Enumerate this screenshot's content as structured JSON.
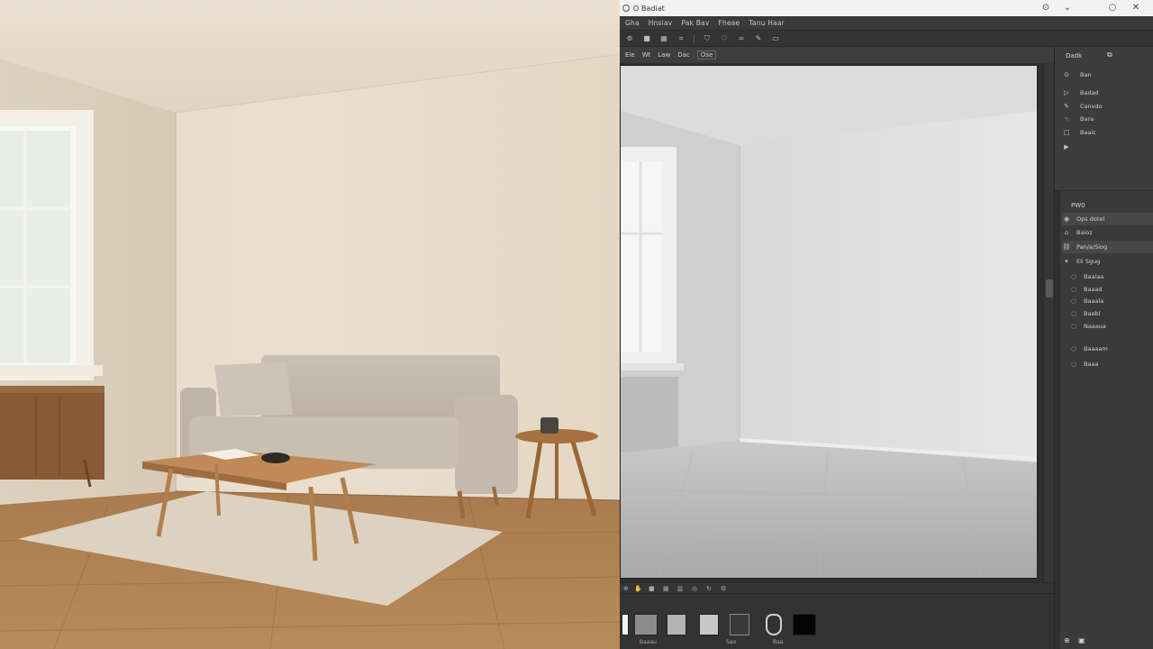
{
  "window": {
    "title": "Badiat"
  },
  "menu": {
    "items": [
      "Gha",
      "Hnsiav",
      "Pak Bav",
      "Fheae",
      "Tanu Haar"
    ]
  },
  "toolbar": {
    "icons": [
      "eye-dropper-icon",
      "layers-icon",
      "grid-icon",
      "crop-icon",
      "heart-icon",
      "lasso-icon",
      "brush-icon",
      "stamp-icon",
      "eraser-icon"
    ]
  },
  "options": {
    "items": [
      "Ele",
      "Wt",
      "Law",
      "Dac",
      "Ose"
    ],
    "box": "Ele"
  },
  "side_panel": {
    "header": "Dadk",
    "subheader": "Ban",
    "items": [
      {
        "icon": "cursor-icon",
        "label": "Badad"
      },
      {
        "icon": "brush-icon",
        "label": "Canvdo"
      },
      {
        "icon": "hand-icon",
        "label": "Bara"
      },
      {
        "icon": "square-icon",
        "label": "Baaic"
      },
      {
        "icon": "play-icon",
        "label": ""
      }
    ]
  },
  "layers": {
    "header": "PW0",
    "rows": [
      {
        "icon": "eye-icon",
        "label": "Ops dotel",
        "selected": true
      },
      {
        "icon": "lock-icon",
        "label": "Baioz",
        "selected": false
      },
      {
        "icon": "link-icon",
        "label": "Pan/a/Siog",
        "selected": true
      },
      {
        "icon": "folder-icon",
        "label": "Eli Sgug",
        "selected": false
      },
      {
        "icon": "layer-icon",
        "label": "Baaiaa",
        "selected": false
      },
      {
        "icon": "layer-icon",
        "label": "Baaad",
        "selected": false
      },
      {
        "icon": "layer-icon",
        "label": "Baaala",
        "selected": false
      },
      {
        "icon": "layer-icon",
        "label": "Baebl",
        "selected": false
      },
      {
        "icon": "layer-icon",
        "label": "Naaaua",
        "selected": false
      },
      {
        "icon": "layer-icon",
        "label": "Baaaam",
        "selected": false
      },
      {
        "icon": "layer-icon",
        "label": "Baaa",
        "selected": false
      }
    ]
  },
  "filmstrip": {
    "labels": [
      "Baaau",
      "Sao",
      "Baa"
    ]
  }
}
